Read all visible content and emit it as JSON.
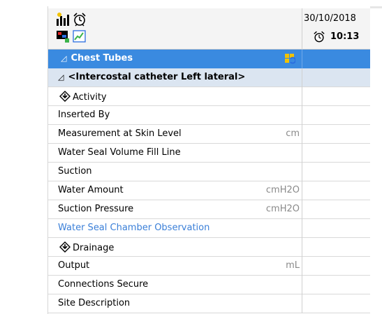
{
  "header": {
    "date": "30/10/2018",
    "time": "10:13",
    "icons": [
      "chart-bars-icon",
      "alarm-clock-icon",
      "flag-icon",
      "line-chart-icon"
    ]
  },
  "section": {
    "title": "Chest Tubes",
    "icon": "refresh-grid-icon"
  },
  "subsection": {
    "title": "<Intercostal catheter Left lateral>"
  },
  "rows": [
    {
      "type": "group",
      "label": "Activity"
    },
    {
      "type": "item",
      "label": "Inserted By",
      "unit": ""
    },
    {
      "type": "item",
      "label": "Measurement at Skin Level",
      "unit": "cm"
    },
    {
      "type": "item",
      "label": "Water Seal Volume Fill Line",
      "unit": ""
    },
    {
      "type": "item",
      "label": "Suction",
      "unit": ""
    },
    {
      "type": "item",
      "label": "Water Amount",
      "unit": "cmH2O"
    },
    {
      "type": "item",
      "label": "Suction Pressure",
      "unit": "cmH2O"
    },
    {
      "type": "link",
      "label": "Water Seal Chamber Observation",
      "unit": ""
    },
    {
      "type": "group",
      "label": "Drainage"
    },
    {
      "type": "item",
      "label": "Output",
      "unit": "mL"
    },
    {
      "type": "item",
      "label": "Connections Secure",
      "unit": ""
    },
    {
      "type": "item",
      "label": "Site Description",
      "unit": ""
    }
  ],
  "colors": {
    "section_bg": "#3a8ae0",
    "subsection_bg": "#dbe5f1",
    "link": "#3a7fd8"
  }
}
